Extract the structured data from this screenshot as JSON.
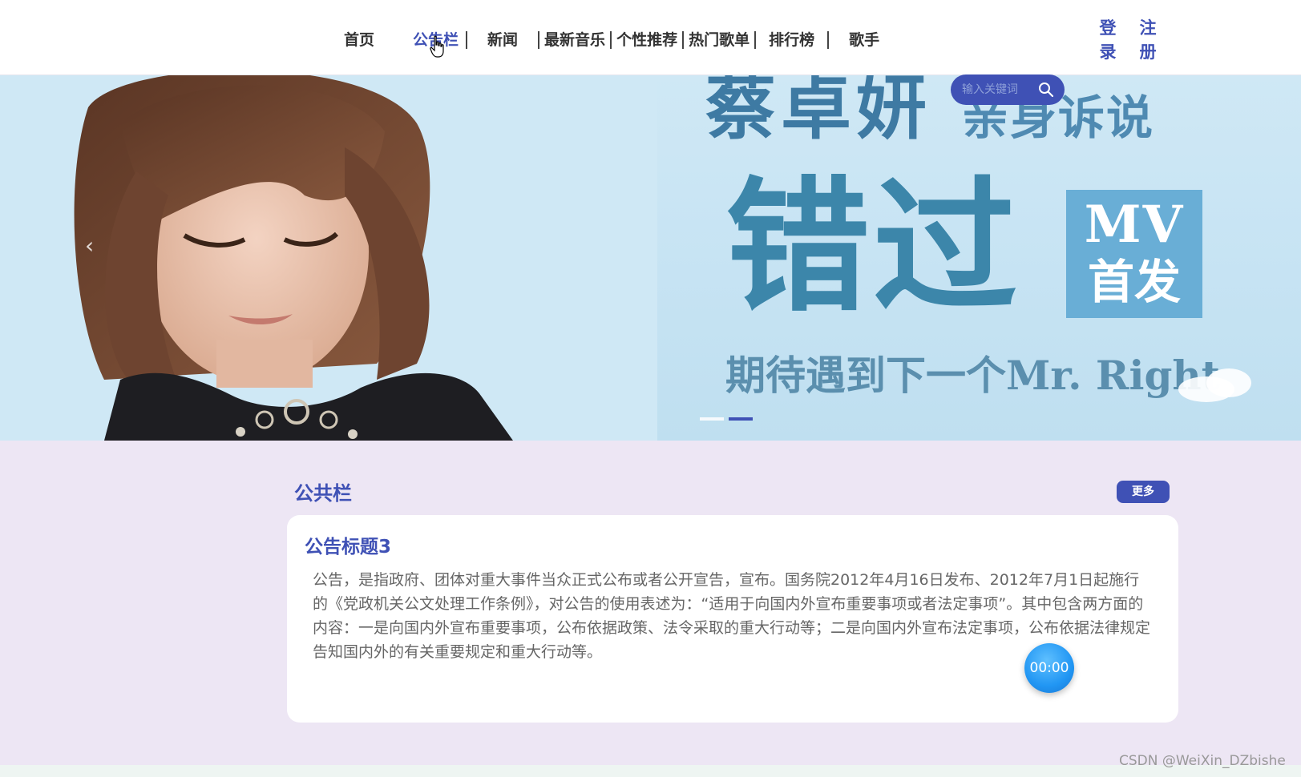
{
  "header": {
    "nav": [
      {
        "label": "首页"
      },
      {
        "label": "公告栏"
      },
      {
        "label": "新闻"
      },
      {
        "label": "最新音乐"
      },
      {
        "label": "个性推荐"
      },
      {
        "label": "热门歌单"
      },
      {
        "label": "排行榜"
      },
      {
        "label": "歌手"
      }
    ],
    "active_nav": "公告栏",
    "login_label": "登录",
    "register_label": "注册"
  },
  "search": {
    "placeholder": "输入关键词",
    "value": ""
  },
  "banner": {
    "artist": "蔡卓妍",
    "subtitle": "亲身诉说",
    "song": "错过",
    "badge_line1": "MV",
    "badge_line2": "首发",
    "tagline": "期待遇到下一个Mr. Right",
    "slide_count": 2,
    "active_slide": 2
  },
  "notice": {
    "section_title": "公共栏",
    "more_label": "更多",
    "item_title": "公告标题3",
    "item_body": "公告，是指政府、团体对重大事件当众正式公布或者公开宣告，宣布。国务院2012年4月16日发布、2012年7月1日起施行的《党政机关公文处理工作条例》，对公告的使用表述为：“适用于向国内外宣布重要事项或者法定事项”。其中包含两方面的内容：一是向国内外宣布重要事项，公布依据政策、法令采取的重大行动等；二是向国内外宣布法定事项，公布依据法律规定告知国内外的有关重要规定和重大行动等。"
  },
  "player": {
    "time": "00:00"
  },
  "watermark": "CSDN @WeiXin_DZbishe",
  "colors": {
    "accent": "#3f51b5",
    "content_bg": "#ede6f4",
    "banner_bg": "#cfe8f5"
  }
}
